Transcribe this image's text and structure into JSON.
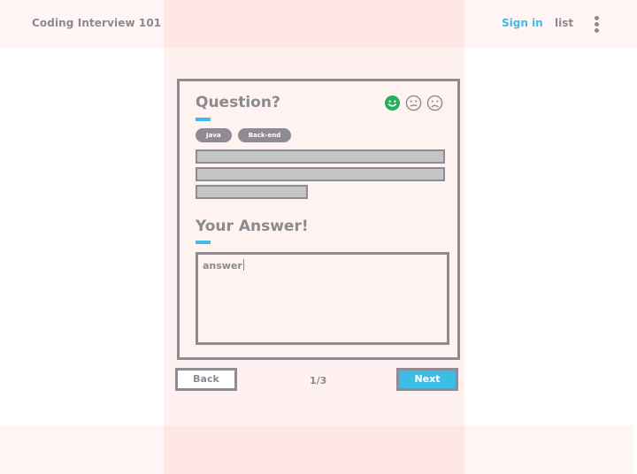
{
  "header": {
    "app_title": "Coding Interview 101",
    "sign_in_label": "Sign in",
    "list_label": "list",
    "more_icon": "more-vertical-icon"
  },
  "question": {
    "title": "Question?",
    "tags": [
      "Java",
      "Back-end"
    ],
    "ratings": {
      "happy_icon": "smiley-happy-icon",
      "neutral_icon": "smiley-neutral-icon",
      "sad_icon": "smiley-sad-icon",
      "selected": "happy",
      "selected_color": "#27ae60"
    }
  },
  "answer": {
    "title": "Your Answer!",
    "value": "answer"
  },
  "nav": {
    "back_label": "Back",
    "next_label": "Next",
    "page_indicator": "1/3"
  },
  "colors": {
    "accent": "#3bbde6",
    "border": "#8f8b94",
    "text": "#8a8a8f",
    "panel": "#fff3f2"
  }
}
